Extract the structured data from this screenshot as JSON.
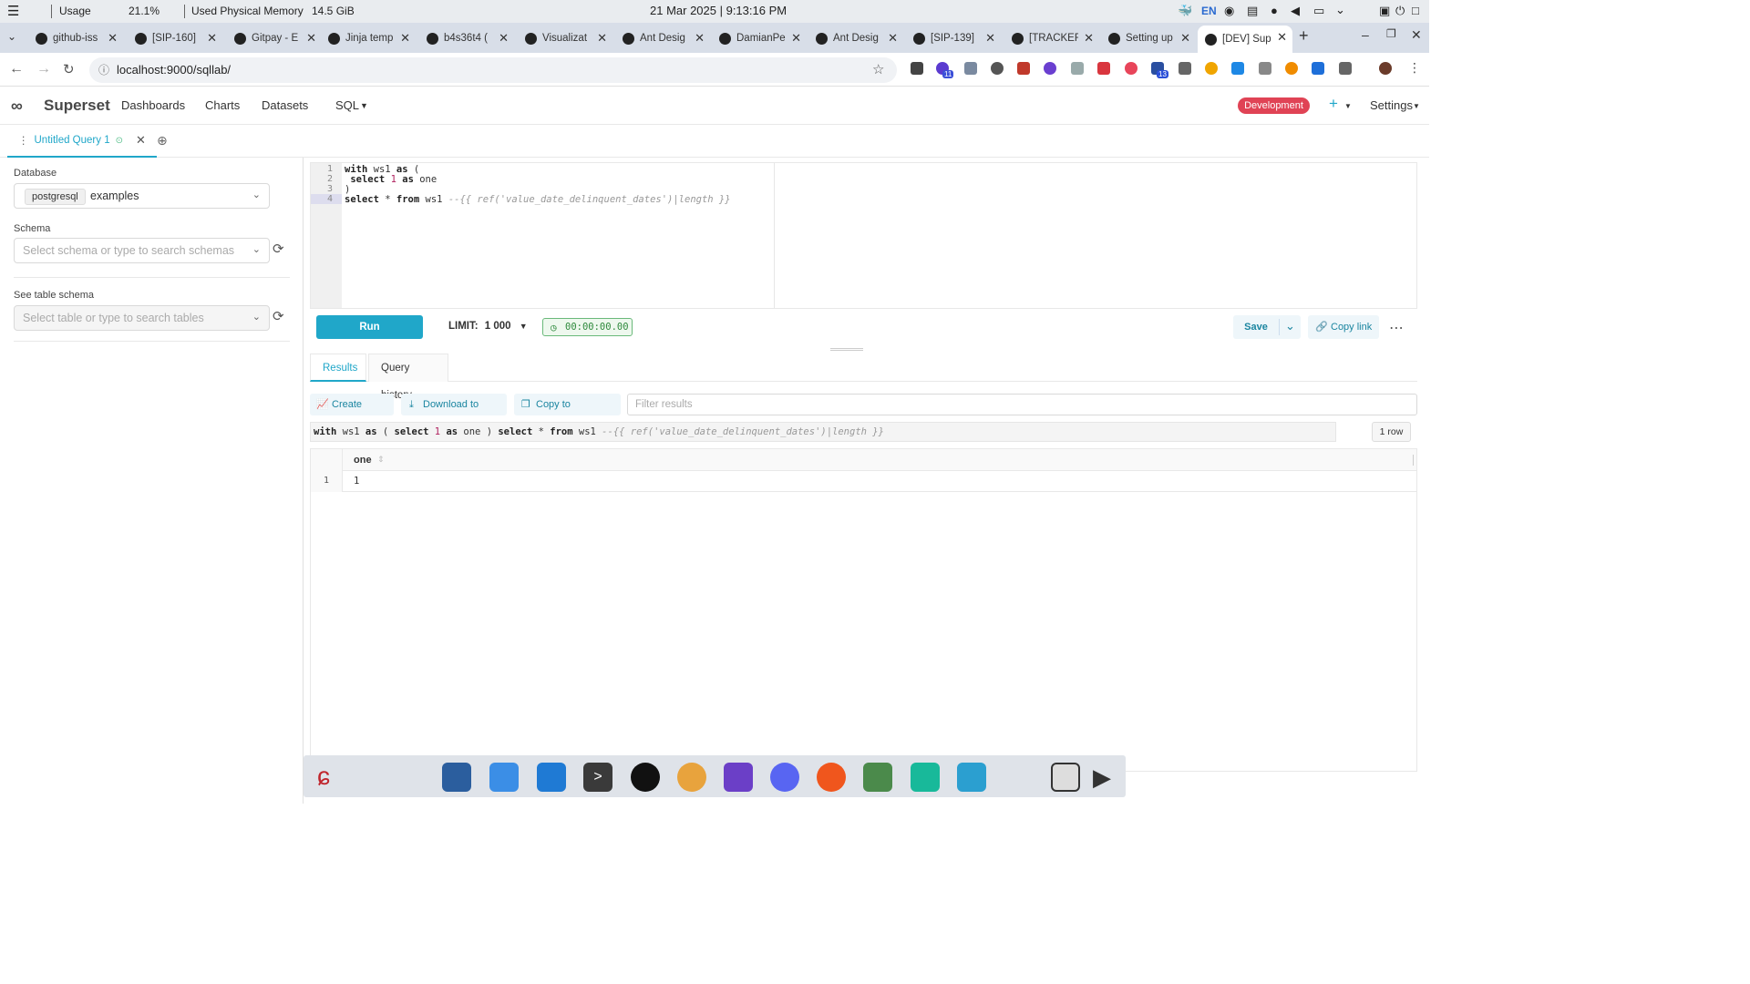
{
  "os_bar": {
    "usage_label": "Usage",
    "usage_value": "21.1%",
    "memory_label": "Used Physical Memory",
    "memory_value": "14.5 GiB",
    "datetime": "21 Mar 2025 | 9:13:16 PM",
    "keyboard_layout": "EN"
  },
  "browser": {
    "tabs": [
      {
        "title": "github-iss",
        "icon": "slack-icon"
      },
      {
        "title": "[SIP-160]",
        "icon": "github-icon"
      },
      {
        "title": "Gitpay - E",
        "icon": "gitpay-icon"
      },
      {
        "title": "Jinja temp",
        "icon": "github-icon"
      },
      {
        "title": "b4s36t4 (",
        "icon": "github-icon"
      },
      {
        "title": "Visualizat",
        "icon": "github-icon"
      },
      {
        "title": "Ant Desig",
        "icon": "github-icon"
      },
      {
        "title": "DamianPe",
        "icon": "github-icon"
      },
      {
        "title": "Ant Desig",
        "icon": "github-icon"
      },
      {
        "title": "[SIP-139]",
        "icon": "github-icon"
      },
      {
        "title": "[TRACKER",
        "icon": "github-icon"
      },
      {
        "title": "Setting up",
        "icon": "link-icon"
      },
      {
        "title": "[DEV] Sup",
        "icon": "superset-icon"
      }
    ],
    "url": "localhost:9000/sqllab/",
    "extension_badges": [
      "11",
      "13"
    ]
  },
  "superset_nav": {
    "brand": "Superset",
    "menu": [
      "Dashboards",
      "Charts",
      "Datasets",
      "SQL"
    ],
    "env_badge": "Development",
    "settings_label": "Settings"
  },
  "query_tab": {
    "title": "Untitled Query 1"
  },
  "left_panel": {
    "database_label": "Database",
    "database_engine": "postgresql",
    "database_name": "examples",
    "schema_label": "Schema",
    "schema_placeholder": "Select schema or type to search schemas",
    "table_label": "See table schema",
    "table_placeholder": "Select table or type to search tables"
  },
  "editor": {
    "line_numbers": [
      "1",
      "2",
      "3",
      "4"
    ],
    "lines": [
      {
        "kw1": "with",
        "t1": " ws1 ",
        "kw2": "as",
        "t2": " ("
      },
      {
        "kw1": "select",
        "num": "1",
        "kw2": "as",
        "t2": " one"
      },
      {
        "t1": ")"
      },
      {
        "kw1": "select",
        "t1": " * ",
        "kw2": "from",
        "t2": " ws1 ",
        "cm": "--{{ ref('value_date_delinquent_dates')|length }}"
      }
    ]
  },
  "toolbar": {
    "run_label": "Run",
    "limit_label": "LIMIT:",
    "limit_value": "1 000",
    "timer": "00:00:00.00",
    "save_label": "Save",
    "copy_link_label": "Copy link"
  },
  "results": {
    "tabs": [
      "Results",
      "Query history"
    ],
    "create_chart_label": "Create Chart",
    "download_csv_label": "Download to CSV",
    "copy_clipboard_label": "Copy to Clipboard",
    "filter_placeholder": "Filter results",
    "executed_sql": {
      "p1": "with",
      "p2": " ws1 ",
      "p3": "as",
      "p4": " ( ",
      "p5": "select",
      "p6": " 1 ",
      "p7": "as",
      "p8": " one ) ",
      "p9": "select",
      "p10": " * ",
      "p11": "from",
      "p12": " ws1 ",
      "p13": "--{{ ref('value_date_delinquent_dates')|length }}"
    },
    "row_count": "1 row",
    "columns": [
      "one"
    ],
    "rows": [
      {
        "index": "1",
        "values": [
          "1"
        ]
      }
    ]
  },
  "colors": {
    "accent": "#20a7c9",
    "env_badge": "#e04355",
    "timer_green": "#2f8a3d"
  }
}
